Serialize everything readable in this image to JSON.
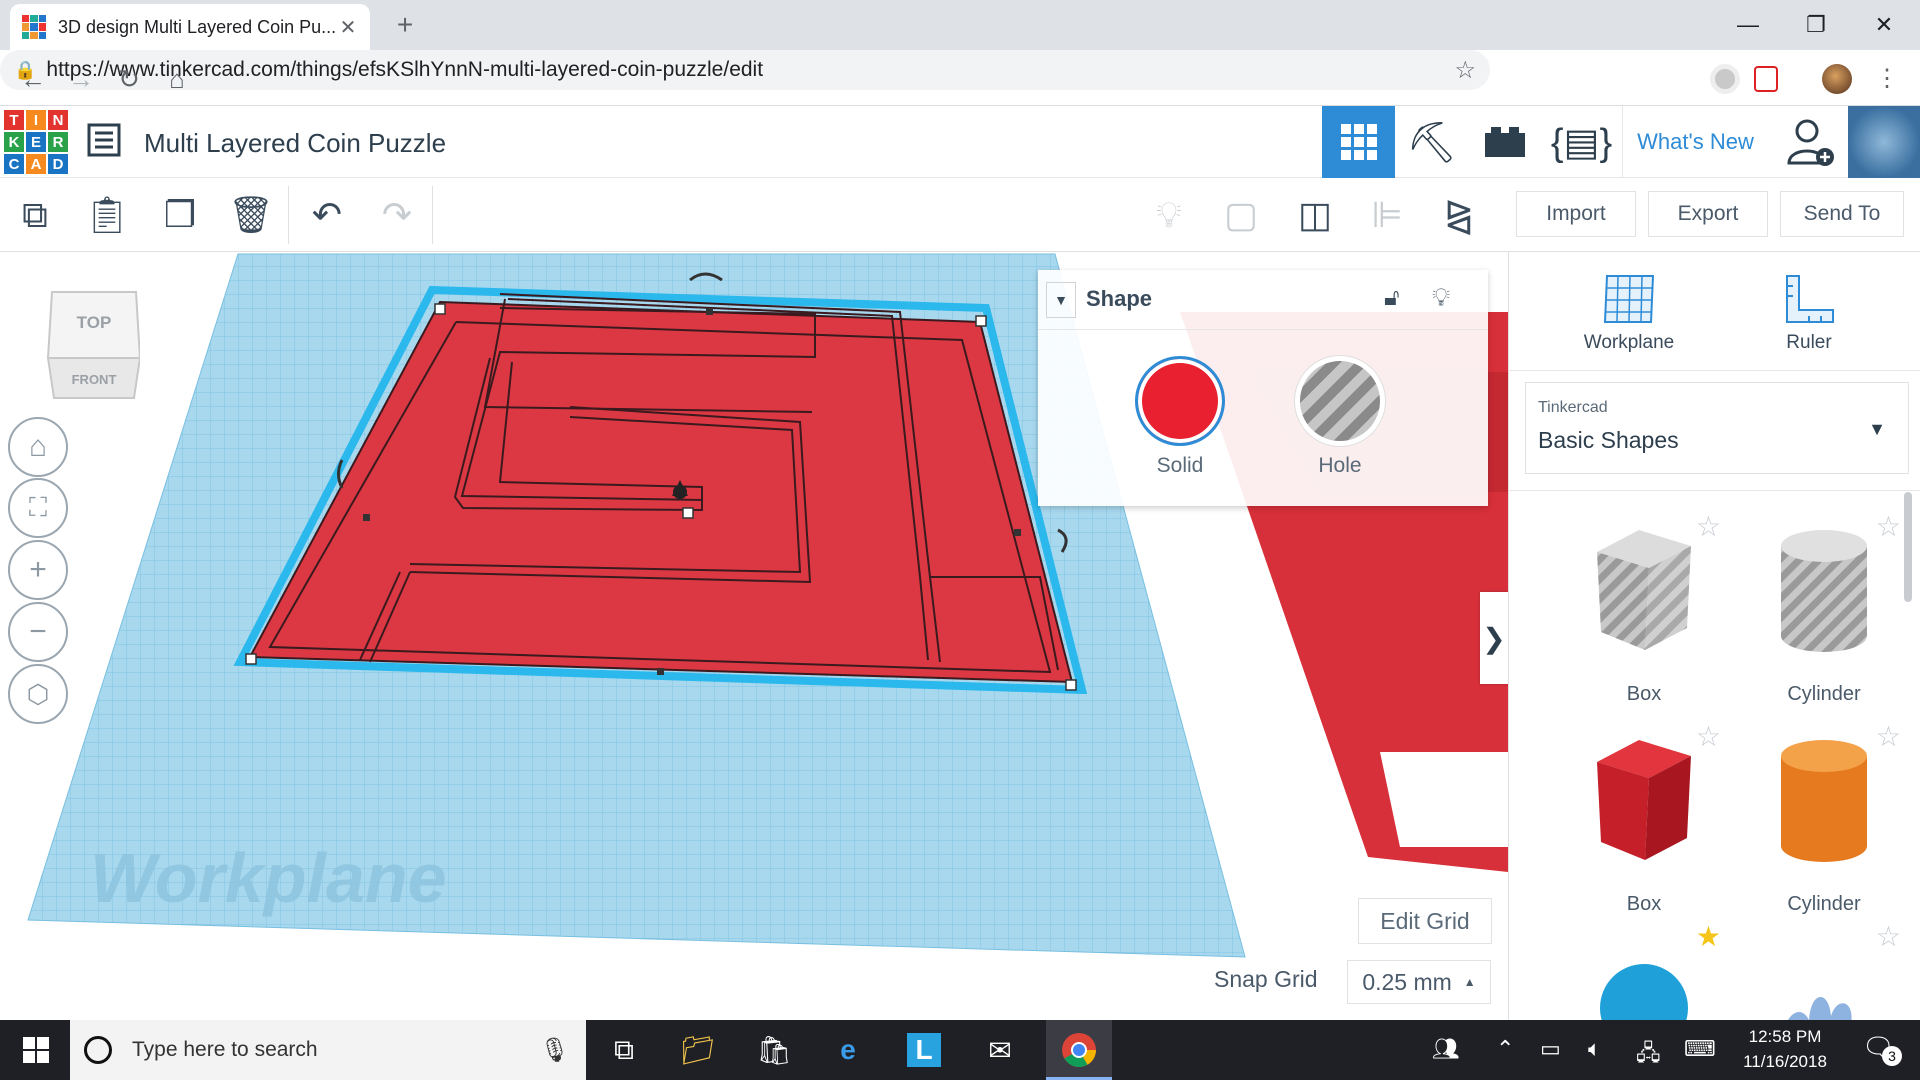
{
  "browser": {
    "tab_title": "3D design Multi Layered Coin Pu...",
    "url": "https://www.tinkercad.com/things/efsKSlhYnnN-multi-layered-coin-puzzle/edit"
  },
  "logo": {
    "letters": [
      "T",
      "I",
      "N",
      "K",
      "E",
      "R",
      "C",
      "A",
      "D"
    ]
  },
  "header": {
    "title": "Multi Layered Coin Puzzle",
    "whats_new": "What's New"
  },
  "toolbar": {
    "import": "Import",
    "export": "Export",
    "send_to": "Send To"
  },
  "viewcube": {
    "top": "TOP",
    "front": "FRONT"
  },
  "workplane": {
    "watermark": "Workplane"
  },
  "inspector": {
    "title": "Shape",
    "solid_label": "Solid",
    "hole_label": "Hole",
    "solid_color": "#e8202f"
  },
  "panel": {
    "workplane_label": "Workplane",
    "ruler_label": "Ruler",
    "library_source": "Tinkercad",
    "library_name": "Basic Shapes",
    "shapes": [
      {
        "label": "Box"
      },
      {
        "label": "Cylinder"
      },
      {
        "label": "Box"
      },
      {
        "label": "Cylinder"
      }
    ]
  },
  "grid": {
    "edit_grid": "Edit Grid",
    "snap_label": "Snap Grid",
    "snap_value": "0.25 mm"
  },
  "taskbar": {
    "search_placeholder": "Type here to search",
    "time": "12:58 PM",
    "date": "11/16/2018",
    "notifications": "3"
  }
}
